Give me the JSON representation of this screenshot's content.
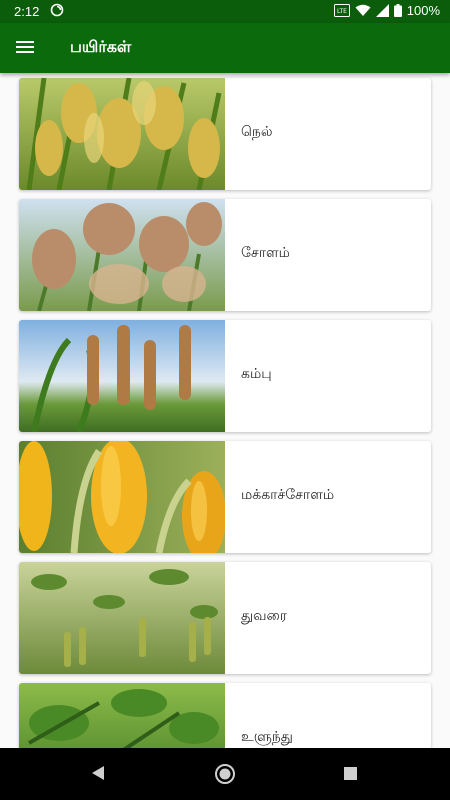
{
  "status_bar": {
    "time": "2:12",
    "battery": "100%",
    "icons": [
      "sync-icon",
      "volte-icon",
      "wifi-icon",
      "signal-icon",
      "battery-icon"
    ]
  },
  "app_bar": {
    "title": "பயிர்கள்",
    "menu_icon": "hamburger-menu-icon"
  },
  "crops": [
    {
      "name": "நெல்"
    },
    {
      "name": "சோளம்"
    },
    {
      "name": "கம்பு"
    },
    {
      "name": "மக்காச்சோளம்"
    },
    {
      "name": "துவரை"
    },
    {
      "name": "உளுந்து"
    }
  ],
  "nav_bar": {
    "back_icon": "back-triangle-icon",
    "home_icon": "home-circle-icon",
    "recents_icon": "recents-square-icon"
  },
  "colors": {
    "status_bar": "#0b5d0b",
    "app_bar": "#0b6a0b"
  }
}
